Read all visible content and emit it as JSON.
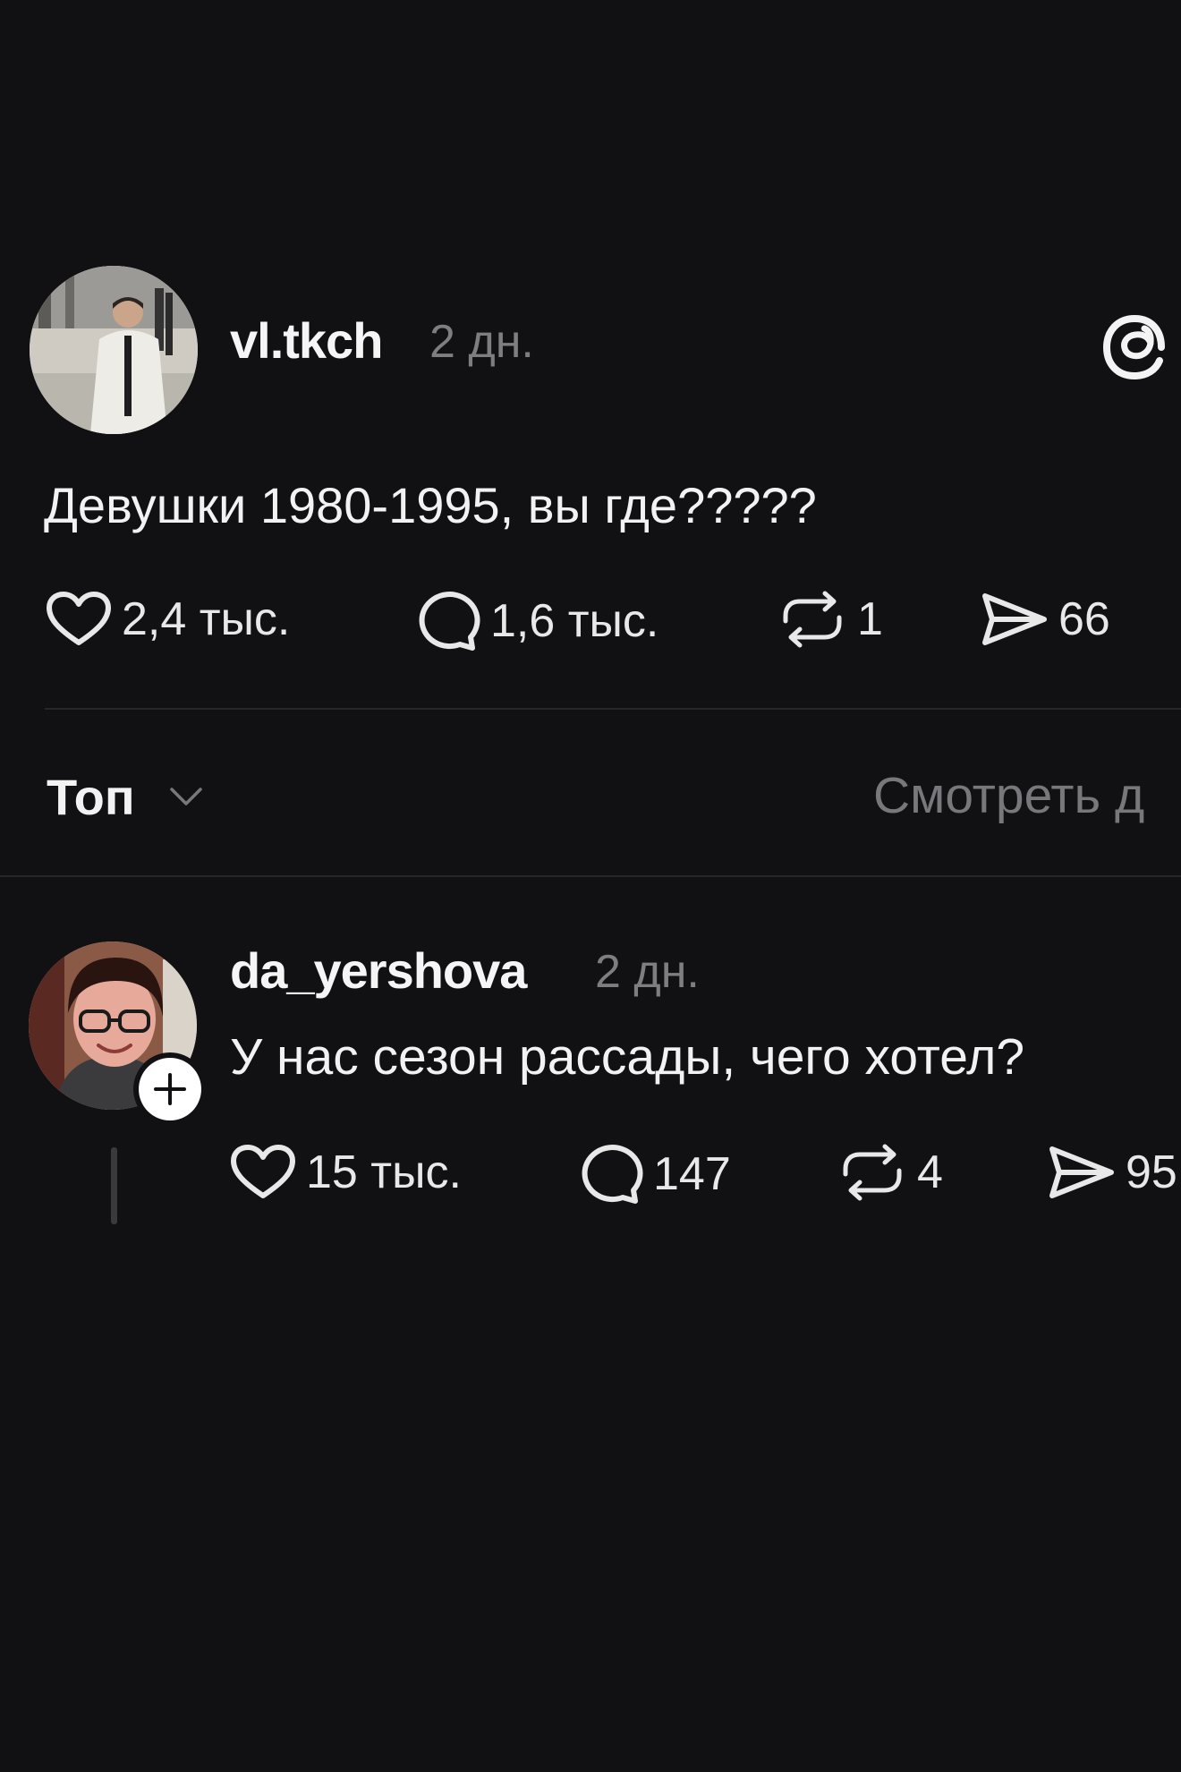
{
  "post": {
    "username": "vl.tkch",
    "time": "2 дн.",
    "text": "Девушки 1980-1995, вы где?????",
    "likes": "2,4 тыс.",
    "replies": "1,6 тыс.",
    "reposts": "1",
    "shares": "66"
  },
  "sort": {
    "label": "Топ",
    "view_activity": "Смотреть д"
  },
  "reply": {
    "username": "da_yershova",
    "time": "2 дн.",
    "text": "У нас сезон рассады, чего хотел?",
    "likes": "15 тыс.",
    "replies": "147",
    "reposts": "4",
    "shares": "95"
  },
  "icons": {
    "like": "heart-icon",
    "reply": "comment-bubble-icon",
    "repost": "repost-icon",
    "share": "send-icon",
    "logo": "threads-logo-icon",
    "sort": "chevron-down-icon",
    "follow": "plus-icon"
  },
  "colors": {
    "background": "#111013",
    "primary_text": "#f3f3f3",
    "secondary_text": "#7d7d82",
    "divider": "#26252a"
  }
}
